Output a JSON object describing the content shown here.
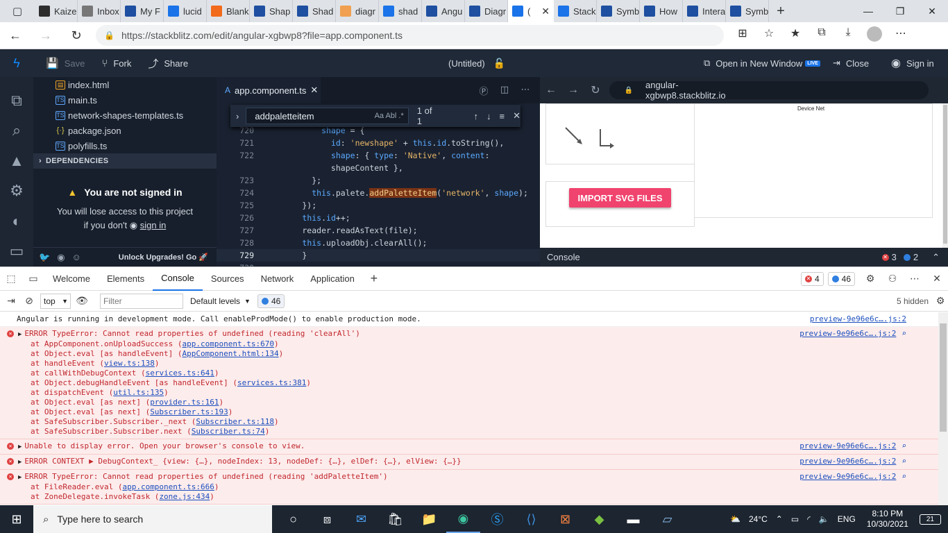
{
  "browser": {
    "tabs": [
      {
        "label": "Kaize",
        "color": "#2d2d2d"
      },
      {
        "label": "Inbox",
        "color": "#777777"
      },
      {
        "label": "My F",
        "color": "#1e4fa0"
      },
      {
        "label": "lucid",
        "color": "#1a73e8"
      },
      {
        "label": "Blank",
        "color": "#f26a1b"
      },
      {
        "label": "Shap",
        "color": "#1e4fa0"
      },
      {
        "label": "Shad",
        "color": "#1e4fa0"
      },
      {
        "label": "diagr",
        "color": "#f0a050"
      },
      {
        "label": "shad",
        "color": "#1a73e8"
      },
      {
        "label": "Angu",
        "color": "#1e4fa0"
      },
      {
        "label": "Diagr",
        "color": "#1e4fa0"
      },
      {
        "label": "(",
        "color": "#1a73e8",
        "active": true
      },
      {
        "label": "Stack",
        "color": "#1a73e8"
      },
      {
        "label": "Symb",
        "color": "#1e4fa0"
      },
      {
        "label": "How",
        "color": "#1e4fa0"
      },
      {
        "label": "Intera",
        "color": "#1e4fa0"
      },
      {
        "label": "Symb",
        "color": "#1e4fa0"
      }
    ],
    "url": "https://stackblitz.com/edit/angular-xgbwp8?file=app.component.ts"
  },
  "stackblitz": {
    "save_label": "Save",
    "fork_label": "Fork",
    "share_label": "Share",
    "project_title": "(Untitled)",
    "open_new_window_label": "Open in New Window",
    "live_badge": "LIVE",
    "close_label": "Close",
    "sign_in_label": "Sign in"
  },
  "sidebar": {
    "files": [
      {
        "name": "index.html",
        "kind": "html"
      },
      {
        "name": "main.ts",
        "kind": "ts"
      },
      {
        "name": "network-shapes-templates.ts",
        "kind": "ts"
      },
      {
        "name": "package.json",
        "kind": "json"
      },
      {
        "name": "polyfills.ts",
        "kind": "ts"
      }
    ],
    "dependencies_label": "DEPENDENCIES",
    "not_signed_title": "You are not signed in",
    "not_signed_line1": "You will lose access to this project",
    "not_signed_line2": "if you don't",
    "sign_in_link": "sign in",
    "unlock_label": "Unlock Upgrades! Go"
  },
  "editor": {
    "tab_label": "app.component.ts",
    "find_query": "addpaletteitem",
    "find_count": "1 of 1",
    "find_opts": "Aa  Abl  .*",
    "lines": [
      {
        "n": "720",
        "html": "shape = {"
      },
      {
        "n": "721",
        "html": "  id: 'newshape' + this.id.toString(),"
      },
      {
        "n": "722",
        "html": "  shape: { type: 'Native', content:"
      },
      {
        "n": "",
        "html": "  shapeContent },"
      },
      {
        "n": "723",
        "html": "};"
      },
      {
        "n": "724",
        "html": "this.palete.addPaletteItem('network', shape);"
      },
      {
        "n": "725",
        "html": "});"
      },
      {
        "n": "726",
        "html": "this.id++;"
      },
      {
        "n": "727",
        "html": "reader.readAsText(file);"
      },
      {
        "n": "728",
        "html": "this.uploadObj.clearAll();"
      },
      {
        "n": "729",
        "html": "}"
      },
      {
        "n": "730",
        "html": ""
      }
    ]
  },
  "preview": {
    "url": "angular-xgbwp8.stackblitz.io",
    "device_net_label": "Device Net",
    "import_button": "IMPORT SVG FILES",
    "console_label": "Console",
    "error_count": "3",
    "info_count": "2"
  },
  "devtools": {
    "tabs": [
      "Welcome",
      "Elements",
      "Console",
      "Sources",
      "Network",
      "Application"
    ],
    "active_tab": "Console",
    "error_badge": "4",
    "msg_badge": "46",
    "context": "top",
    "filter_placeholder": "Filter",
    "levels_label": "Default levels",
    "levels_count": "46",
    "hidden_label": "5 hidden",
    "messages": [
      {
        "type": "log",
        "text": "Angular is running in development mode. Call enableProdMode() to enable production mode.",
        "src": "preview-9e96e6c….js:2"
      },
      {
        "type": "error",
        "text": "ERROR TypeError: Cannot read properties of undefined (reading 'clearAll')",
        "src": "preview-9e96e6c….js:2",
        "stack": [
          [
            "at AppComponent.onUploadSuccess (",
            "app.component.ts:670",
            ")"
          ],
          [
            "at Object.eval [as handleEvent] (",
            "AppComponent.html:134",
            ")"
          ],
          [
            "at handleEvent (",
            "view.ts:138",
            ")"
          ],
          [
            "at callWithDebugContext (",
            "services.ts:641",
            ")"
          ],
          [
            "at Object.debugHandleEvent [as handleEvent] (",
            "services.ts:381",
            ")"
          ],
          [
            "at dispatchEvent (",
            "util.ts:135",
            ")"
          ],
          [
            "at Object.eval [as next] (",
            "provider.ts:161",
            ")"
          ],
          [
            "at Object.eval [as next] (",
            "Subscriber.ts:193",
            ")"
          ],
          [
            "at SafeSubscriber.Subscriber._next (",
            "Subscriber.ts:118",
            ")"
          ],
          [
            "at SafeSubscriber.Subscriber.next (",
            "Subscriber.ts:74",
            ")"
          ]
        ]
      },
      {
        "type": "error",
        "text": "Unable to display error. Open your browser's console to view.",
        "src": "preview-9e96e6c….js:2",
        "stack": []
      },
      {
        "type": "error",
        "text": "ERROR CONTEXT ▶ DebugContext_ {view: {…}, nodeIndex: 13, nodeDef: {…}, elDef: {…}, elView: {…}}",
        "src": "preview-9e96e6c….js:2",
        "stack": []
      },
      {
        "type": "error",
        "text": "ERROR TypeError: Cannot read properties of undefined (reading 'addPaletteItem')",
        "src": "preview-9e96e6c….js:2",
        "stack": [
          [
            "at FileReader.eval (",
            "app.component.ts:666",
            ")"
          ],
          [
            "at ZoneDelegate.invokeTask (",
            "zone.js:434",
            ")"
          ]
        ]
      }
    ]
  },
  "taskbar": {
    "search_placeholder": "Type here to search",
    "temperature": "24°C",
    "language": "ENG",
    "time": "8:10 PM",
    "date": "10/30/2021",
    "notif_count": "21"
  }
}
